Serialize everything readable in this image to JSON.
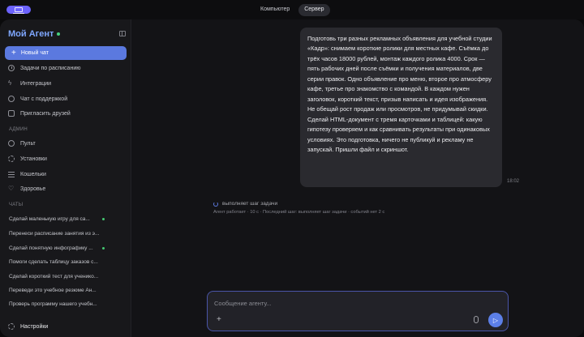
{
  "topbar": {
    "tabs": [
      "Компьютер",
      "Сервер"
    ],
    "active_tab": "Сервер"
  },
  "sidebar": {
    "brand": "Мой Агент",
    "new_chat": "Новый чат",
    "items": [
      {
        "label": "Задачи по расписанию",
        "icon": "clock-icon"
      },
      {
        "label": "Интеграции",
        "icon": "plug-icon"
      },
      {
        "label": "Чат с поддержкой",
        "icon": "support-icon"
      },
      {
        "label": "Пригласить друзей",
        "icon": "gift-icon"
      }
    ],
    "admin_label": "АДМИН",
    "admin_items": [
      {
        "label": "Пульт",
        "icon": "dashboard-icon"
      },
      {
        "label": "Установки",
        "icon": "settings-icon"
      },
      {
        "label": "Кошельки",
        "icon": "wallet-icon"
      },
      {
        "label": "Здоровье",
        "icon": "health-icon"
      }
    ],
    "chats_label": "ЧАТЫ",
    "chats": [
      {
        "label": "Сделай маленькую игру для са...",
        "dot": true
      },
      {
        "label": "Перенеси расписание занятия из э...",
        "dot": false
      },
      {
        "label": "Сделай понятную инфографику ...",
        "dot": true
      },
      {
        "label": "Помоги сделать таблицу заказов с...",
        "dot": false
      },
      {
        "label": "Сделай короткий тест для ученико...",
        "dot": false
      },
      {
        "label": "Переведи это учебное резюме Ан...",
        "dot": false
      },
      {
        "label": "Проверь программу нашего учебн...",
        "dot": false
      }
    ],
    "settings": "Настройки"
  },
  "conversation": {
    "message": "Подготовь три разных рекламных объявления для учебной студии «Кадр»: снимаем короткие ролики для местных кафе. Съёмка до трёх часов 18000 рублей, монтаж каждого ролика 4000. Срок — пять рабочих дней после съёмки и получения материалов, две серии правок. Одно объявление про меню, второе про атмосферу кафе, третье про знакомство с командой. В каждом нужен заголовок, короткий текст, призыв написать и идея изображения. Не обещай рост продаж или просмотров, не придумывай скидки. Сделай HTML-документ с тремя карточками и таблицей: какую гипотезу проверяем и как сравнивать результаты при одинаковых условиях. Это подготовка, ничего не публикуй и рекламу не запускай. Пришли файл и скриншот.",
    "time": "18:02",
    "task_status": "выполняет шаг задачи",
    "agent_meta": "Агент работает · 10 с · Последний шаг: выполняет шаг задачи · событий нет 2 с"
  },
  "composer": {
    "placeholder": "Сообщение агенту...",
    "add_label": "+",
    "send_icon": "send-icon",
    "mic_icon": "mic-icon"
  },
  "colors": {
    "accent": "#5b79df",
    "brand": "#7fa7ff",
    "active_dot": "#44c972"
  }
}
